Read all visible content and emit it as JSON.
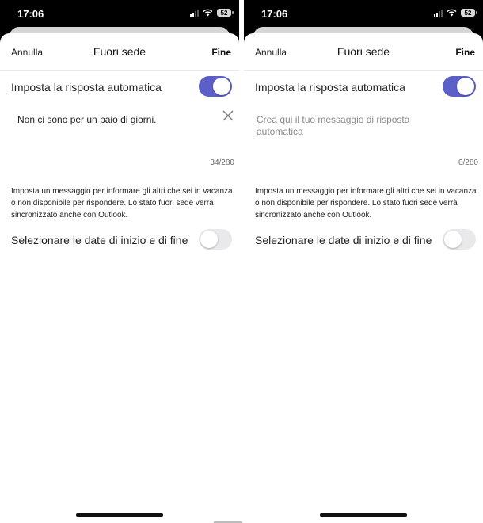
{
  "status_bar": {
    "time": "17:06",
    "battery": "52"
  },
  "nav": {
    "cancel": "Annulla",
    "title": "Fuori sede",
    "done": "Fine"
  },
  "auto_reply": {
    "label": "Imposta la risposta automatica",
    "enabled": true
  },
  "screens": {
    "filled": {
      "message": "Non ci sono per un paio di giorni.",
      "counter": "34/280"
    },
    "empty": {
      "placeholder": "Crea qui il tuo messaggio di risposta automatica",
      "counter": "0/280"
    }
  },
  "info_text": "Imposta un messaggio per informare gli altri che sei in vacanza o non disponibile per rispondere. Lo stato fuori sede verrà sincronizzato anche con Outlook.",
  "dates": {
    "label": "Selezionare le date di inizio e di fine",
    "enabled": false
  },
  "colors": {
    "accent": "#5b5fc7",
    "toggle_off": "#e9e9eb"
  },
  "icons": {
    "clear": "close-icon",
    "signal": "cellular-signal-icon",
    "wifi": "wifi-icon",
    "battery": "battery-icon"
  }
}
